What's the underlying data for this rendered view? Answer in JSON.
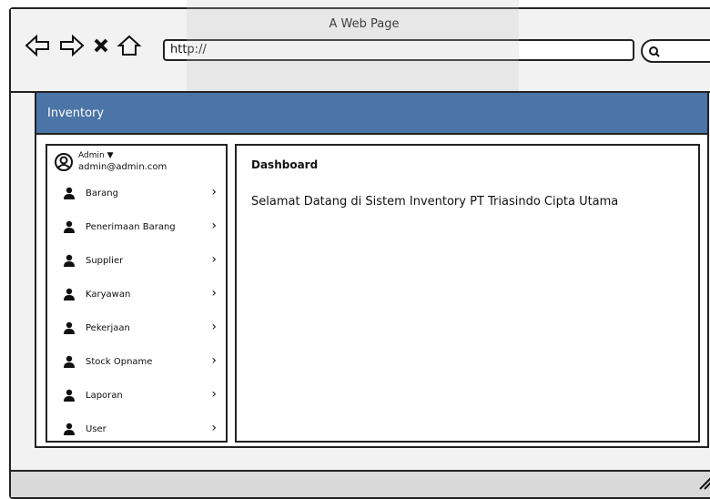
{
  "browser": {
    "title": "A Web Page",
    "address": "http://",
    "icons": [
      "back-arrow-icon",
      "forward-arrow-icon",
      "close-icon",
      "home-icon",
      "search-icon"
    ]
  },
  "app": {
    "header_title": "Inventory",
    "user": {
      "name": "Admin",
      "email": "admin@admin.com"
    },
    "menu": [
      {
        "label": "Barang"
      },
      {
        "label": "Penerimaan Barang"
      },
      {
        "label": "Supplier"
      },
      {
        "label": "Karyawan"
      },
      {
        "label": "Pekerjaan"
      },
      {
        "label": "Stock Opname"
      },
      {
        "label": "Laporan"
      },
      {
        "label": "User"
      }
    ],
    "main": {
      "title": "Dashboard",
      "welcome": "Selamat Datang di Sistem Inventory PT Triasindo Cipta Utama"
    },
    "colors": {
      "header": "#4b74a7"
    }
  }
}
